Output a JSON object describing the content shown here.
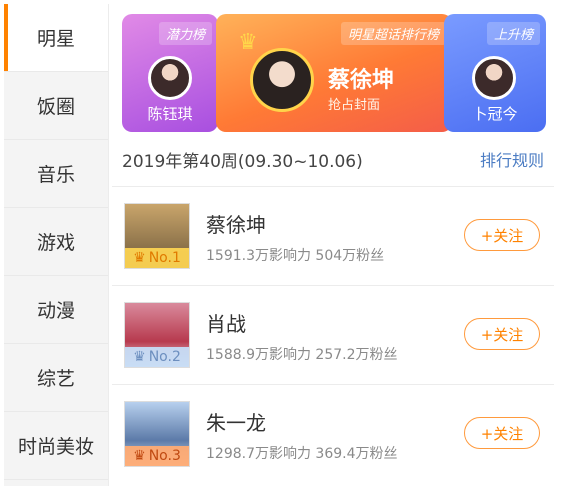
{
  "sidebar": {
    "items": [
      {
        "label": "明星",
        "active": true
      },
      {
        "label": "饭圈",
        "active": false
      },
      {
        "label": "音乐",
        "active": false
      },
      {
        "label": "游戏",
        "active": false
      },
      {
        "label": "动漫",
        "active": false
      },
      {
        "label": "综艺",
        "active": false
      },
      {
        "label": "时尚美妆",
        "active": false
      }
    ]
  },
  "banner": {
    "left": {
      "ribbon": "潜力榜",
      "name": "陈钰琪"
    },
    "center": {
      "ribbon": "明星超话排行榜",
      "name": "蔡徐坤",
      "subtitle": "抢占封面",
      "crown_icon": "crown-icon"
    },
    "right": {
      "ribbon": "上升榜",
      "name": "卜冠今"
    }
  },
  "week": {
    "label": "2019年第40周(09.30~10.06)",
    "rules_link": "排行规则"
  },
  "ranking": [
    {
      "rank_label": "No.1",
      "name": "蔡徐坤",
      "stats": "1591.3万影响力 504万粉丝",
      "follow_label": "+关注"
    },
    {
      "rank_label": "No.2",
      "name": "肖战",
      "stats": "1588.9万影响力 257.2万粉丝",
      "follow_label": "+关注"
    },
    {
      "rank_label": "No.3",
      "name": "朱一龙",
      "stats": "1298.7万影响力 369.4万粉丝",
      "follow_label": "+关注"
    }
  ],
  "colors": {
    "accent": "#ff8200",
    "link": "#4b7cc3",
    "potential_card": "#b65ee3",
    "main_card": "#ff7a35",
    "rising_card": "#5a7ff5"
  }
}
